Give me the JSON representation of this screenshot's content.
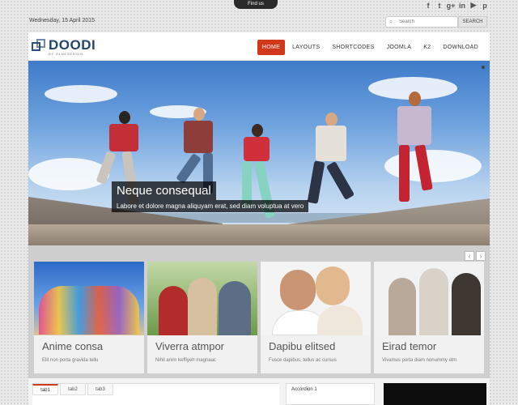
{
  "topbar": {
    "find_us": "Find us",
    "date": "Wednesday, 15 April 2015",
    "social_icons": [
      "facebook-icon",
      "twitter-icon",
      "google-plus-icon",
      "linkedin-icon",
      "youtube-icon",
      "pinterest-icon"
    ],
    "search_placeholder": "Search",
    "search_button": "SEARCH"
  },
  "header": {
    "logo_text": "DOODI",
    "logo_tagline": "BY OLNESERIDN",
    "nav": [
      "HOME",
      "LAYOUTS",
      "SHORTCODES",
      "JOOMLA",
      "K2",
      "DOWNLOAD"
    ],
    "active_nav": "HOME"
  },
  "slider": {
    "title": "Neque consequal",
    "text": "Labore et dolore magna aliquyam erat, sed diam voluptua at vero"
  },
  "carousel": {
    "prev": "‹",
    "next": "›",
    "cards": [
      {
        "title": "Anime consa",
        "text": "Elit non porta gravida tellu"
      },
      {
        "title": "Viverra atmpor",
        "text": "Nihil anim keffiyeh magnaac"
      },
      {
        "title": "Dapibu elitsed",
        "text": "Fusce dapibus, tellus ac cursus"
      },
      {
        "title": "Eirad temor",
        "text": "Vivamus porta diam nonummy elm"
      }
    ]
  },
  "bottom": {
    "tabs": [
      "tab1",
      "tab2",
      "tab3"
    ],
    "accordion_title": "Accordion 1"
  },
  "colors": {
    "accent": "#d0371b",
    "logo": "#22466d"
  }
}
